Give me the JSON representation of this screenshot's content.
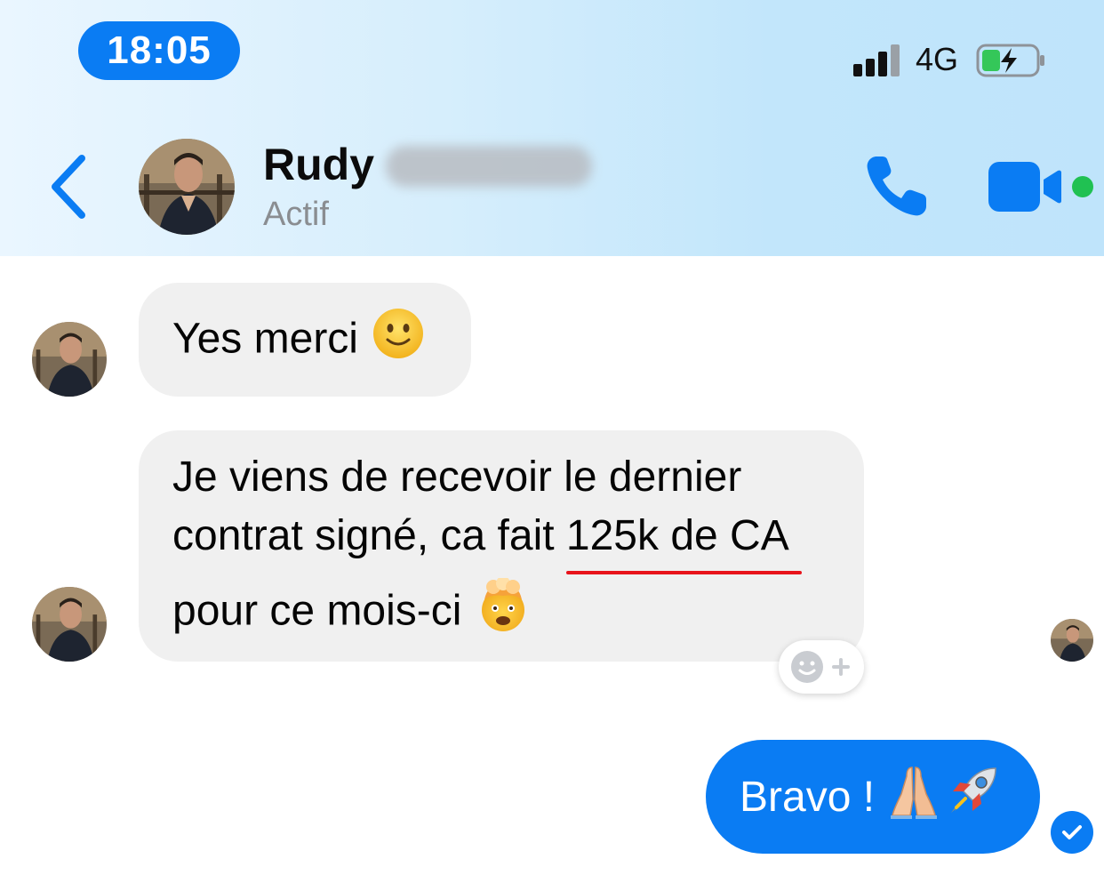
{
  "status_bar": {
    "time": "18:05",
    "network": "4G"
  },
  "conversation": {
    "contact_name": "Rudy",
    "contact_status": "Actif"
  },
  "messages": [
    {
      "direction": "in",
      "text": "Yes merci",
      "emoji": "slightly-smiling-face"
    },
    {
      "direction": "in",
      "line1": "Je viens de recevoir le dernier",
      "line2_plain": "contrat signé, ca fait ",
      "line2_underlined": "125k de CA",
      "line3": "pour ce mois-ci",
      "emoji": "exploding-head"
    },
    {
      "direction": "out",
      "text": "Bravo !",
      "emoji": [
        "folded-hands",
        "rocket"
      ]
    }
  ],
  "colors": {
    "accent_blue": "#0a7cf3",
    "incoming_bubble": "#f0f0f0",
    "online_green": "#20c152",
    "underline_red": "#e8131b"
  },
  "icons": [
    "back-chevron-icon",
    "phone-icon",
    "video-camera-icon",
    "add-reaction-icon",
    "check-icon",
    "signal-icon",
    "battery-charging-icon"
  ]
}
